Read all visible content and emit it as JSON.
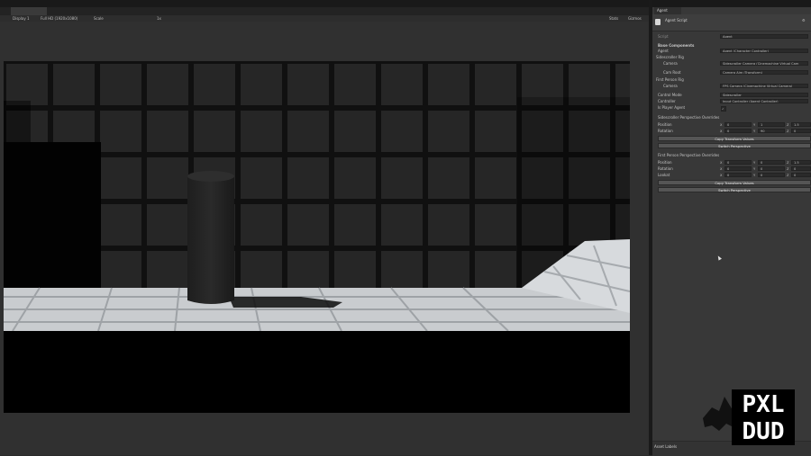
{
  "toolbar": {
    "display": "Display 1",
    "resolution": "Full HD (1920x1080)",
    "scale_label": "Scale",
    "scale_value": "1x",
    "stats": "Stats",
    "gizmos": "Gizmos"
  },
  "inspector": {
    "tab_title": "Agent",
    "object_name": "Agent Script",
    "script_field": "Agent",
    "base_components": "Base Components",
    "agent_label": "Agent",
    "agent_value": "Agent (Character Controller)",
    "sideways_label": "Sidescroller Rig",
    "sideways_camera_label": "Camera",
    "sideways_camera_value": "Sidescroller Camera (Cinemachine Virtual Cam",
    "cam_root_label": "Cam Root",
    "cam_root_value": "Camera Aim (Transform)",
    "fp_rig_label": "First Person Rig",
    "fp_camera_label": "Camera",
    "fp_camera_value": "FPS Camera (Cinemachine Virtual Camera)",
    "control_mode_label": "Control Mode",
    "control_mode_value": "Sidescroller",
    "controller_label": "Controller",
    "controller_value": "Input Controller (Agent Controller)",
    "is_player_label": "Is Player Agent",
    "sidescroller_persp_title": "Sidescroller Perspective Overrides",
    "fp_persp_title": "First Person Perspective Overrides",
    "position_label": "Position",
    "rotation_label": "Rotation",
    "lookat_label": "Lookat",
    "sc_pos": [
      "0",
      "1",
      "1.5"
    ],
    "sc_rot": [
      "0",
      "90",
      "0"
    ],
    "fp_pos": [
      "0",
      "0",
      "1.5"
    ],
    "fp_rot": [
      "0",
      "0",
      "0"
    ],
    "fp_look": [
      "0",
      "0",
      "0"
    ],
    "btn_copy_1": "Copy Transform Values",
    "btn_switch_1": "Switch Perspective",
    "btn_copy_2": "Copy Transform Values",
    "btn_switch_2": "Switch Perspective",
    "footer": "Asset Labels"
  },
  "logo": {
    "line1": "PXL",
    "line2": "DUD"
  }
}
